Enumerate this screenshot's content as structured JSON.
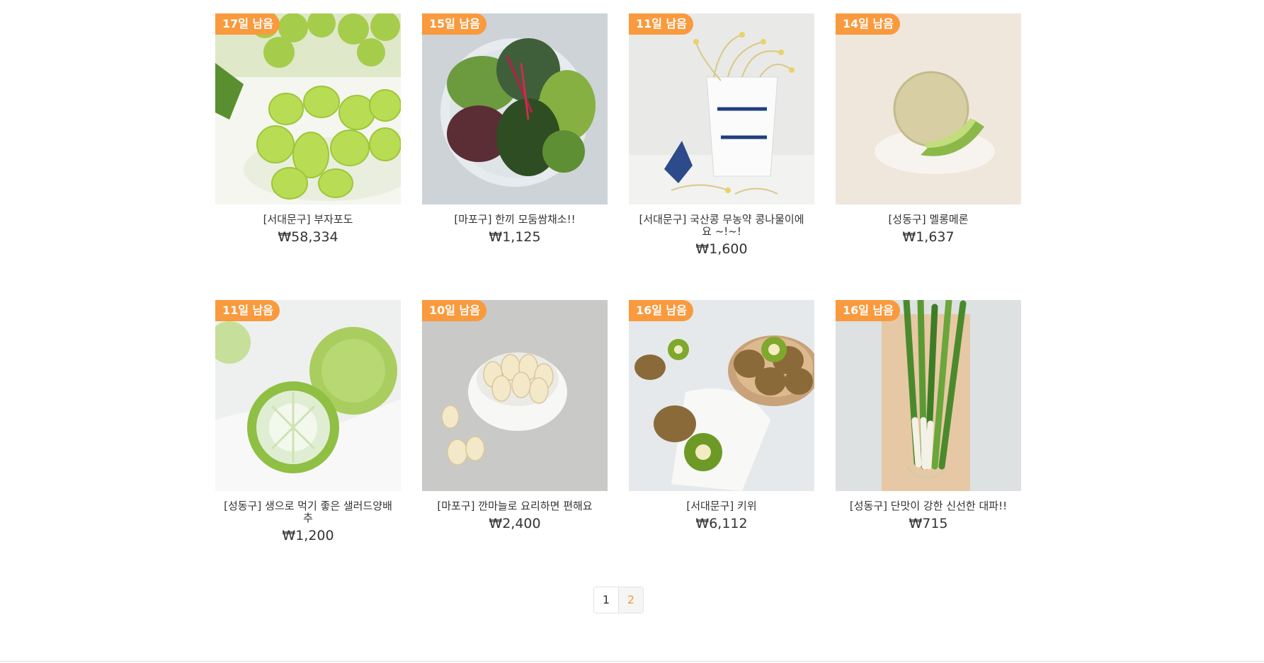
{
  "products": [
    {
      "badge": "17일 남음",
      "name": "[서대문구] 부자포도",
      "price": "₩58,334",
      "image": "grapes"
    },
    {
      "badge": "15일 남음",
      "name": "[마포구] 한끼 모둠쌈채소!!",
      "price": "₩1,125",
      "image": "salad-greens"
    },
    {
      "badge": "11일 남음",
      "name": "[서대문구] 국산콩 무농약 콩나물이에요 ~!~!",
      "price": "₩1,600",
      "image": "bean-sprouts"
    },
    {
      "badge": "14일 남음",
      "name": "[성동구] 멜롱메론",
      "price": "₩1,637",
      "image": "melon"
    },
    {
      "badge": "11일 남음",
      "name": "[성동구] 생으로 먹기 좋은 샐러드양배추",
      "price": "₩1,200",
      "image": "cabbage"
    },
    {
      "badge": "10일 남음",
      "name": "[마포구] 깐마늘로 요리하면 편해요",
      "price": "₩2,400",
      "image": "garlic"
    },
    {
      "badge": "16일 남음",
      "name": "[서대문구] 키위",
      "price": "₩6,112",
      "image": "kiwi"
    },
    {
      "badge": "16일 남음",
      "name": "[성동구] 단맛이 강한 신선한 대파!!",
      "price": "₩715",
      "image": "green-onion"
    }
  ],
  "pagination": {
    "pages": [
      "1",
      "2"
    ],
    "current": "2"
  },
  "colors": {
    "badge": "#f99a3e",
    "current_page": "#f99a3e"
  }
}
